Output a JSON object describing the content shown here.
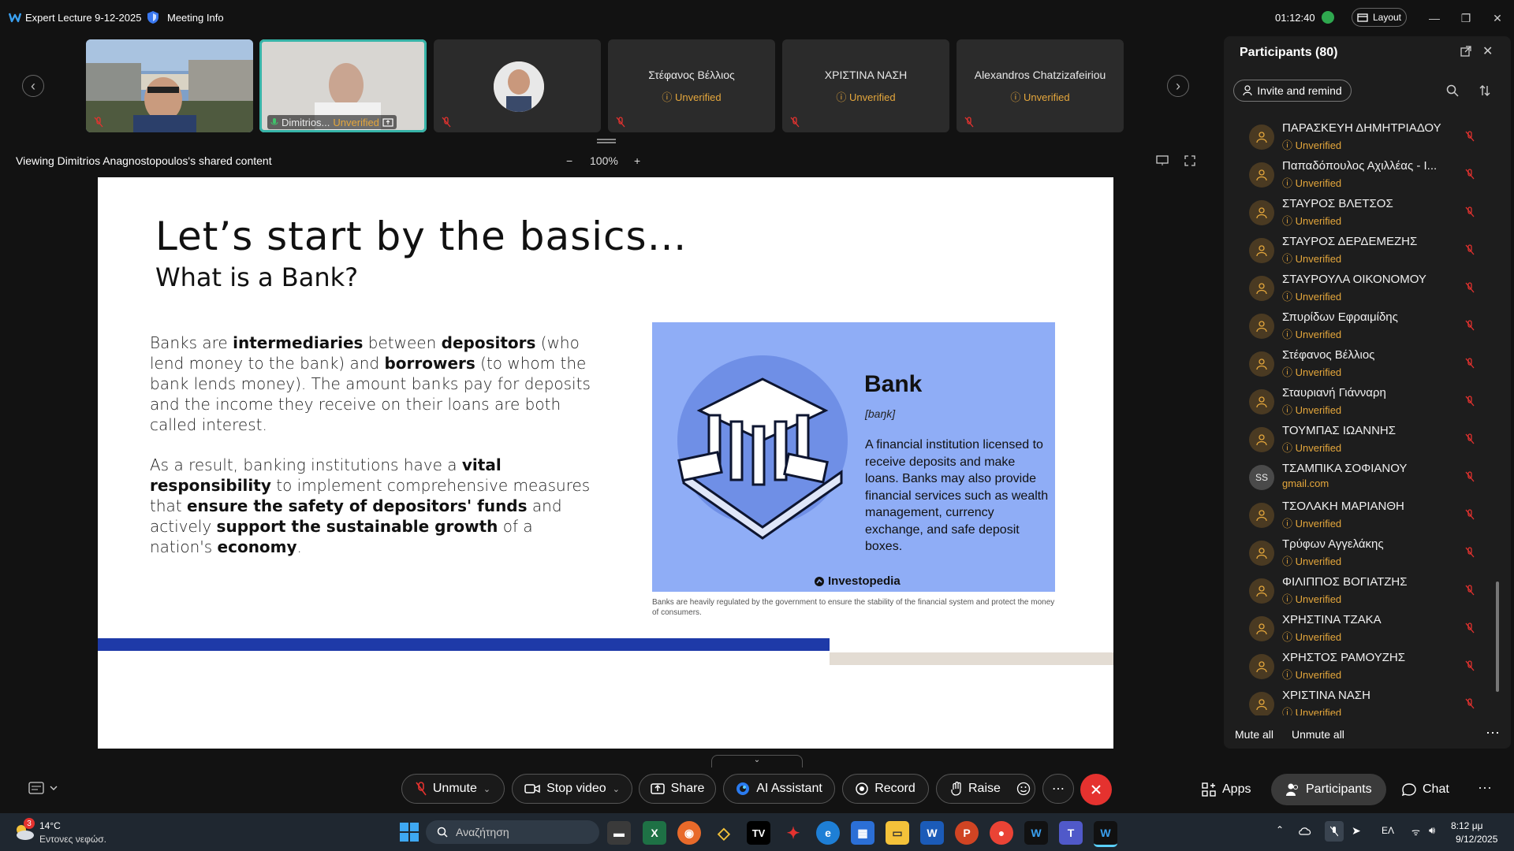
{
  "titlebar": {
    "title": "Expert Lecture 9-12-2025",
    "meeting_info": "Meeting Info",
    "elapsed": "01:12:40",
    "layout_label": "Layout"
  },
  "video_strip": [
    {
      "name": "",
      "status": ""
    },
    {
      "name": "Dimitrios...",
      "status": "Unverified"
    },
    {
      "name": "",
      "status": ""
    },
    {
      "name": "Στέφανος Βέλλιος",
      "status": "Unverified"
    },
    {
      "name": "ΧΡΙΣΤΙΝΑ ΝΑΣΗ",
      "status": "Unverified"
    },
    {
      "name": "Alexandros Chatzizafeiriou",
      "status": "Unverified"
    }
  ],
  "share_header": {
    "viewing": "Viewing Dimitrios Anagnostopoulos's shared content",
    "zoom": "100%",
    "minus": "−",
    "plus": "+"
  },
  "slide": {
    "title": "Let’s start by the basics…",
    "subtitle": "What is a Bank?",
    "para1": [
      {
        "t": "Banks are ",
        "b": false
      },
      {
        "t": "intermediaries",
        "b": true
      },
      {
        "t": " between ",
        "b": false
      },
      {
        "t": "depositors",
        "b": true
      },
      {
        "t": " (who lend money to the bank) and ",
        "b": false
      },
      {
        "t": "borrowers",
        "b": true
      },
      {
        "t": " (to whom the bank lends money). The amount banks pay for deposits and the income they receive on their loans are both called interest.",
        "b": false
      }
    ],
    "para2": [
      {
        "t": "As a result, banking institutions have a ",
        "b": false
      },
      {
        "t": "vital responsibility",
        "b": true
      },
      {
        "t": " to implement comprehensive measures that ",
        "b": false
      },
      {
        "t": "ensure the safety of depositors' funds",
        "b": true
      },
      {
        "t": " and actively ",
        "b": false
      },
      {
        "t": "support the sustainable growth",
        "b": true
      },
      {
        "t": " of a nation's ",
        "b": false
      },
      {
        "t": "economy",
        "b": true
      },
      {
        "t": ".",
        "b": false
      }
    ],
    "image": {
      "heading": "Bank",
      "phonetic": "[baŋk]",
      "definition": "A financial institution licensed to receive deposits and make loans. Banks may also provide financial services such as wealth management, currency exchange, and safe deposit boxes.",
      "brand": "Investopedia",
      "bg_color": "#8fadf6"
    },
    "caption": "Banks are heavily regulated by the government to ensure the stability of the financial system and protect the money of consumers."
  },
  "participants": {
    "title": "Participants (80)",
    "invite_label": "Invite and remind",
    "items": [
      {
        "name": "ΠΑΡΑΣΚΕΥΗ ΔΗΜΗΤΡΙΑΔΟΥ",
        "status": "Unverified",
        "avatar": ""
      },
      {
        "name": "Παπαδόπουλος Αχιλλέας - I...",
        "status": "Unverified",
        "avatar": ""
      },
      {
        "name": "ΣΤΑΥΡΟΣ ΒΛΕΤΣΟΣ",
        "status": "Unverified",
        "avatar": ""
      },
      {
        "name": "ΣΤΑΥΡΟΣ ΔΕΡΔΕΜΕΖΗΣ",
        "status": "Unverified",
        "avatar": ""
      },
      {
        "name": "ΣΤΑΥΡΟΥΛΑ ΟΙΚΟΝΟΜΟΥ",
        "status": "Unverified",
        "avatar": ""
      },
      {
        "name": "Σπυρίδων Εφραιμίδης",
        "status": "Unverified",
        "avatar": ""
      },
      {
        "name": "Στέφανος Βέλλιος",
        "status": "Unverified",
        "avatar": ""
      },
      {
        "name": "Σταυριανή Γιάνναρη",
        "status": "Unverified",
        "avatar": ""
      },
      {
        "name": "ΤΟΥΜΠΑΣ ΙΩΑΝΝΗΣ",
        "status": "Unverified",
        "avatar": ""
      },
      {
        "name": "ΤΣΑΜΠΙΚΑ ΣΟΦΙΑΝΟΥ",
        "status": "gmail.com",
        "avatar": "SS"
      },
      {
        "name": "ΤΣΟΛΑΚΗ ΜΑΡΙΑΝΘΗ",
        "status": "Unverified",
        "avatar": ""
      },
      {
        "name": "Τρύφων Αγγελάκης",
        "status": "Unverified",
        "avatar": ""
      },
      {
        "name": "ΦΙΛΙΠΠΟΣ ΒΟΓΙΑΤΖΗΣ",
        "status": "Unverified",
        "avatar": ""
      },
      {
        "name": "ΧΡΗΣΤΙΝΑ ΤΖΑΚΑ",
        "status": "Unverified",
        "avatar": ""
      },
      {
        "name": "ΧΡΗΣΤΟΣ ΡΑΜΟΥΖΗΣ",
        "status": "Unverified",
        "avatar": ""
      },
      {
        "name": "ΧΡΙΣΤΙΝΑ ΝΑΣΗ",
        "status": "Unverified",
        "avatar": ""
      }
    ],
    "mute_all": "Mute all",
    "unmute_all": "Unmute all"
  },
  "toolbar": {
    "unmute": "Unmute",
    "stop_video": "Stop video",
    "share": "Share",
    "ai_assistant": "AI Assistant",
    "record": "Record",
    "raise": "Raise",
    "apps": "Apps",
    "participants": "Participants",
    "chat": "Chat"
  },
  "taskbar": {
    "weather_badge": "3",
    "temp": "14°C",
    "weather_desc": "Εντονες νεφώσ.",
    "search_placeholder": "Αναζήτηση",
    "lang": "ΕΛ",
    "time": "8:12 μμ",
    "date": "9/12/2025"
  },
  "colors": {
    "accent_teal": "#36b3a7",
    "warning": "#e5a73c",
    "end_red": "#e5322f",
    "slide_blue": "#1e3aa8"
  }
}
